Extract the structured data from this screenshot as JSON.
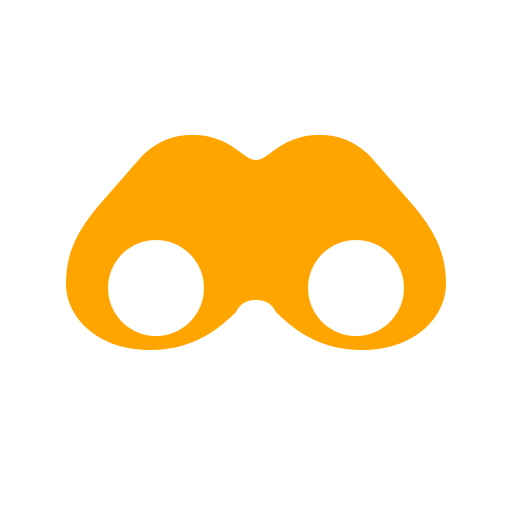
{
  "icon": {
    "name": "binoculars-icon",
    "color": "#FFA500",
    "background": "#FFFFFF"
  }
}
